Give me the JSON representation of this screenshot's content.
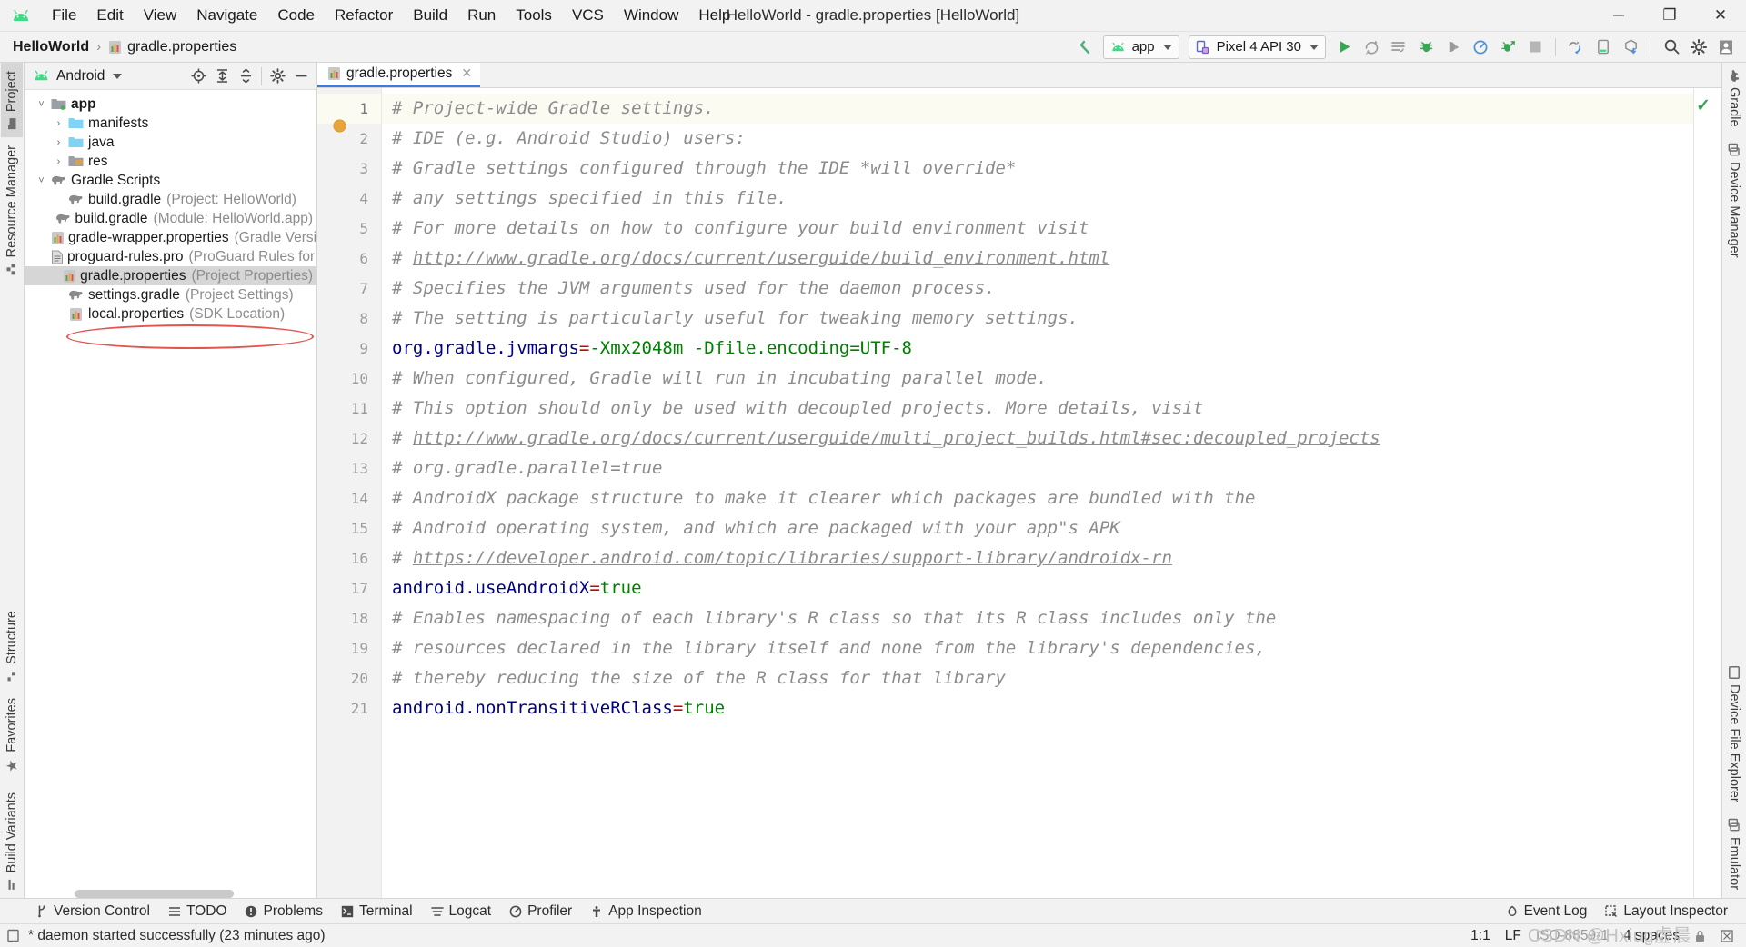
{
  "window": {
    "title": "HelloWorld - gradle.properties [HelloWorld]",
    "minimize_label": "─",
    "maximize_label": "❐",
    "close_label": "✕"
  },
  "menubar": {
    "items": [
      {
        "label": "File"
      },
      {
        "label": "Edit"
      },
      {
        "label": "View"
      },
      {
        "label": "Navigate"
      },
      {
        "label": "Code"
      },
      {
        "label": "Refactor"
      },
      {
        "label": "Build"
      },
      {
        "label": "Run"
      },
      {
        "label": "Tools"
      },
      {
        "label": "VCS"
      },
      {
        "label": "Window"
      },
      {
        "label": "Help"
      }
    ]
  },
  "navbar": {
    "breadcrumb": [
      {
        "label": "HelloWorld",
        "bold": true
      },
      {
        "label": "gradle.properties",
        "bold": false
      }
    ],
    "separator": "›",
    "run_config": "app",
    "device": "Pixel 4 API 30"
  },
  "project_panel": {
    "title": "Android",
    "tree": [
      {
        "indent": 0,
        "arrow": "down",
        "icon": "module-folder-icon",
        "label": "app",
        "bold": true,
        "meta": "",
        "selected": false
      },
      {
        "indent": 1,
        "arrow": "right",
        "icon": "folder-icon",
        "label": "manifests",
        "bold": false,
        "meta": "",
        "selected": false
      },
      {
        "indent": 1,
        "arrow": "right",
        "icon": "folder-icon",
        "label": "java",
        "bold": false,
        "meta": "",
        "selected": false
      },
      {
        "indent": 1,
        "arrow": "right",
        "icon": "res-folder-icon",
        "label": "res",
        "bold": false,
        "meta": "",
        "selected": false
      },
      {
        "indent": 0,
        "arrow": "down",
        "icon": "gradle-elephant-icon",
        "label": "Gradle Scripts",
        "bold": false,
        "meta": "",
        "selected": false
      },
      {
        "indent": 1,
        "arrow": "none",
        "icon": "gradle-elephant-icon",
        "label": "build.gradle",
        "bold": false,
        "meta": "(Project: HelloWorld)",
        "selected": false
      },
      {
        "indent": 1,
        "arrow": "none",
        "icon": "gradle-elephant-icon",
        "label": "build.gradle",
        "bold": false,
        "meta": "(Module: HelloWorld.app)",
        "selected": false
      },
      {
        "indent": 1,
        "arrow": "none",
        "icon": "properties-file-icon",
        "label": "gradle-wrapper.properties",
        "bold": false,
        "meta": "(Gradle Version)",
        "selected": false
      },
      {
        "indent": 1,
        "arrow": "none",
        "icon": "text-file-icon",
        "label": "proguard-rules.pro",
        "bold": false,
        "meta": "(ProGuard Rules for Hell",
        "selected": false
      },
      {
        "indent": 1,
        "arrow": "none",
        "icon": "properties-file-icon",
        "label": "gradle.properties",
        "bold": false,
        "meta": "(Project Properties)",
        "selected": true
      },
      {
        "indent": 1,
        "arrow": "none",
        "icon": "gradle-elephant-icon",
        "label": "settings.gradle",
        "bold": false,
        "meta": "(Project Settings)",
        "selected": false
      },
      {
        "indent": 1,
        "arrow": "none",
        "icon": "properties-file-icon",
        "label": "local.properties",
        "bold": false,
        "meta": "(SDK Location)",
        "selected": false
      }
    ]
  },
  "left_strip": {
    "top": [
      {
        "label": "Project",
        "icon": "project-icon",
        "active": true
      },
      {
        "label": "Resource Manager",
        "icon": "resource-manager-icon",
        "active": false
      }
    ],
    "bottom": [
      {
        "label": "Structure",
        "icon": "structure-icon",
        "active": false
      },
      {
        "label": "Favorites",
        "icon": "star-icon",
        "active": false
      },
      {
        "label": "Build Variants",
        "icon": "build-variants-icon",
        "active": false
      }
    ]
  },
  "right_strip": {
    "top": [
      {
        "label": "Gradle",
        "icon": "gradle-elephant-icon"
      },
      {
        "label": "Device Manager",
        "icon": "device-manager-icon"
      }
    ],
    "bottom": [
      {
        "label": "Device File Explorer",
        "icon": "device-file-explorer-icon"
      },
      {
        "label": "Emulator",
        "icon": "emulator-icon"
      }
    ]
  },
  "editor": {
    "tab": {
      "label": "gradle.properties",
      "close": "✕",
      "icon": "properties-file-icon"
    },
    "lines": [
      {
        "n": 1,
        "current": true,
        "tokens": [
          {
            "t": "comment",
            "s": "# Project-wide Gradle settings."
          }
        ]
      },
      {
        "n": 2,
        "current": false,
        "tokens": [
          {
            "t": "comment",
            "s": "# IDE (e.g. Android Studio) users:"
          }
        ]
      },
      {
        "n": 3,
        "current": false,
        "tokens": [
          {
            "t": "comment",
            "s": "# Gradle settings configured through the IDE *will override*"
          }
        ]
      },
      {
        "n": 4,
        "current": false,
        "tokens": [
          {
            "t": "comment",
            "s": "# any settings specified in this file."
          }
        ]
      },
      {
        "n": 5,
        "current": false,
        "tokens": [
          {
            "t": "comment",
            "s": "# For more details on how to configure your build environment visit"
          }
        ]
      },
      {
        "n": 6,
        "current": false,
        "tokens": [
          {
            "t": "comment",
            "s": "# "
          },
          {
            "t": "comment-link",
            "s": "http://www.gradle.org/docs/current/userguide/build_environment.html"
          }
        ]
      },
      {
        "n": 7,
        "current": false,
        "tokens": [
          {
            "t": "comment",
            "s": "# Specifies the JVM arguments used for the daemon process."
          }
        ]
      },
      {
        "n": 8,
        "current": false,
        "tokens": [
          {
            "t": "comment",
            "s": "# The setting is particularly useful for tweaking memory settings."
          }
        ]
      },
      {
        "n": 9,
        "current": false,
        "tokens": [
          {
            "t": "key",
            "s": "org.gradle.jvmargs"
          },
          {
            "t": "eq",
            "s": "="
          },
          {
            "t": "value",
            "s": "-Xmx2048m -Dfile.encoding=UTF-8"
          }
        ]
      },
      {
        "n": 10,
        "current": false,
        "tokens": [
          {
            "t": "comment",
            "s": "# When configured, Gradle will run in incubating parallel mode."
          }
        ]
      },
      {
        "n": 11,
        "current": false,
        "tokens": [
          {
            "t": "comment",
            "s": "# This option should only be used with decoupled projects. More details, visit"
          }
        ]
      },
      {
        "n": 12,
        "current": false,
        "tokens": [
          {
            "t": "comment",
            "s": "# "
          },
          {
            "t": "comment-link",
            "s": "http://www.gradle.org/docs/current/userguide/multi_project_builds.html#sec:decoupled_projects"
          }
        ]
      },
      {
        "n": 13,
        "current": false,
        "tokens": [
          {
            "t": "comment",
            "s": "# org.gradle.parallel=true"
          }
        ]
      },
      {
        "n": 14,
        "current": false,
        "tokens": [
          {
            "t": "comment",
            "s": "# AndroidX package structure to make it clearer which packages are bundled with the"
          }
        ]
      },
      {
        "n": 15,
        "current": false,
        "tokens": [
          {
            "t": "comment",
            "s": "# Android operating system, and which are packaged with your app\"s APK"
          }
        ]
      },
      {
        "n": 16,
        "current": false,
        "tokens": [
          {
            "t": "comment",
            "s": "# "
          },
          {
            "t": "comment-link",
            "s": "https://developer.android.com/topic/libraries/support-library/androidx-rn"
          }
        ]
      },
      {
        "n": 17,
        "current": false,
        "tokens": [
          {
            "t": "key",
            "s": "android.useAndroidX"
          },
          {
            "t": "eq",
            "s": "="
          },
          {
            "t": "value",
            "s": "true"
          }
        ]
      },
      {
        "n": 18,
        "current": false,
        "tokens": [
          {
            "t": "comment",
            "s": "# Enables namespacing of each library's R class so that its R class includes only the"
          }
        ]
      },
      {
        "n": 19,
        "current": false,
        "tokens": [
          {
            "t": "comment",
            "s": "# resources declared in the library itself and none from the library's dependencies,"
          }
        ]
      },
      {
        "n": 20,
        "current": false,
        "tokens": [
          {
            "t": "comment",
            "s": "# thereby reducing the size of the R class for that library"
          }
        ]
      },
      {
        "n": 21,
        "current": false,
        "tokens": [
          {
            "t": "key",
            "s": "android.nonTransitiveRClass"
          },
          {
            "t": "eq",
            "s": "="
          },
          {
            "t": "value",
            "s": "true"
          }
        ]
      }
    ]
  },
  "tool_windows": {
    "items": [
      {
        "label": "Version Control",
        "icon": "branch-icon"
      },
      {
        "label": "TODO",
        "icon": "list-icon"
      },
      {
        "label": "Problems",
        "icon": "problems-icon"
      },
      {
        "label": "Terminal",
        "icon": "terminal-icon"
      },
      {
        "label": "Logcat",
        "icon": "logcat-icon"
      },
      {
        "label": "Profiler",
        "icon": "profiler-icon"
      },
      {
        "label": "App Inspection",
        "icon": "app-inspection-icon"
      }
    ],
    "right": [
      {
        "label": "Event Log",
        "icon": "event-log-icon"
      },
      {
        "label": "Layout Inspector",
        "icon": "layout-inspector-icon"
      }
    ]
  },
  "statusbar": {
    "message": "* daemon started successfully (23 minutes ago)",
    "caret": "1:1",
    "line_separator": "LF",
    "encoding": "ISO-8859-1",
    "indent": "4 spaces",
    "watermark": "CSDN @Hxiug虚晨"
  },
  "colors": {
    "accent_blue": "#3b7ddd",
    "android_green": "#3ddc84",
    "comment_gray": "#8c8c8c",
    "key_navy": "#000080",
    "value_green": "#008000",
    "eq_red": "#cc0000",
    "annotation_red": "#e0554d",
    "selection_gray": "#d6d6d6"
  }
}
